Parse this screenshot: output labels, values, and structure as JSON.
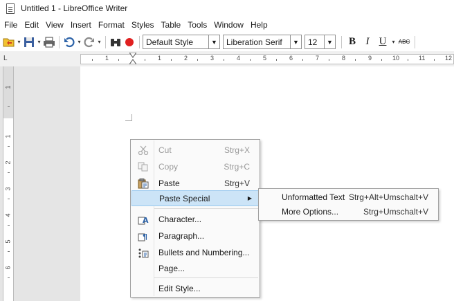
{
  "window": {
    "title": "Untitled 1 - LibreOffice Writer"
  },
  "menubar": [
    "File",
    "Edit",
    "View",
    "Insert",
    "Format",
    "Styles",
    "Table",
    "Tools",
    "Window",
    "Help"
  ],
  "toolbar": {
    "paragraph_style": "Default Style",
    "font_name": "Liberation Serif",
    "font_size": "12",
    "bold": "B",
    "italic": "I",
    "underline": "U",
    "strikethrough": "ABC"
  },
  "ruler": {
    "corner": "L",
    "h_numbers": [
      "1",
      "1",
      "2",
      "3",
      "4",
      "5",
      "6",
      "7",
      "8",
      "9",
      "10",
      "11",
      "12"
    ],
    "v_numbers": [
      "1",
      "1",
      "2",
      "3",
      "4",
      "5",
      "6"
    ]
  },
  "context_menu": {
    "items": [
      {
        "label": "Cut",
        "shortcut": "Strg+X",
        "icon": "scissors-icon",
        "disabled": true
      },
      {
        "label": "Copy",
        "shortcut": "Strg+C",
        "icon": "copy-icon",
        "disabled": true
      },
      {
        "label": "Paste",
        "shortcut": "Strg+V",
        "icon": "paste-icon",
        "disabled": false
      },
      {
        "label": "Paste Special",
        "shortcut": "",
        "icon": "",
        "disabled": false,
        "submenu": true
      },
      {
        "label": "Character...",
        "shortcut": "",
        "icon": "character-icon"
      },
      {
        "label": "Paragraph...",
        "shortcut": "",
        "icon": "paragraph-icon"
      },
      {
        "label": "Bullets and Numbering...",
        "shortcut": "",
        "icon": "bullets-icon"
      },
      {
        "label": "Page...",
        "shortcut": "",
        "icon": ""
      },
      {
        "label": "Edit Style...",
        "shortcut": "",
        "icon": ""
      }
    ]
  },
  "submenu": {
    "items": [
      {
        "label": "Unformatted Text",
        "shortcut": "Strg+Alt+Umschalt+V"
      },
      {
        "label": "More Options...",
        "shortcut": "Strg+Umschalt+V"
      }
    ]
  },
  "colors": {
    "highlight": "#cce4f7",
    "highlight_border": "#99c9ef",
    "record": "#e02020"
  }
}
